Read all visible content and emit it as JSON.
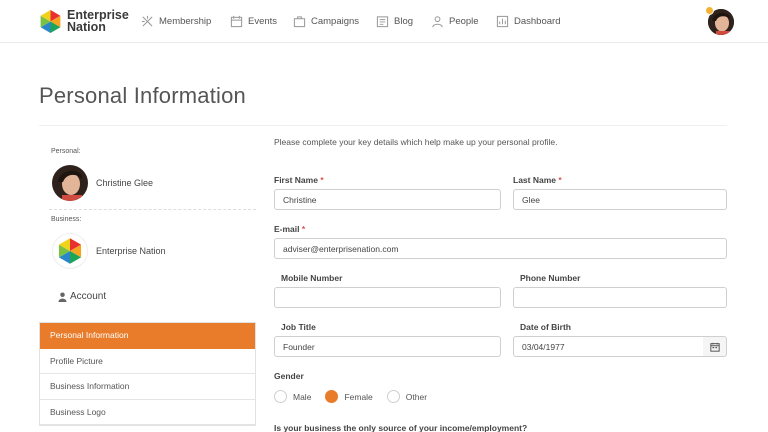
{
  "header": {
    "logo_line1": "Enterprise",
    "logo_line2": "Nation",
    "nav": [
      {
        "label": "Membership",
        "icon": "membership-icon"
      },
      {
        "label": "Events",
        "icon": "events-icon"
      },
      {
        "label": "Campaigns",
        "icon": "campaigns-icon"
      },
      {
        "label": "Blog",
        "icon": "blog-icon"
      },
      {
        "label": "People",
        "icon": "people-icon"
      },
      {
        "label": "Dashboard",
        "icon": "dashboard-icon"
      }
    ]
  },
  "page": {
    "title": "Personal Information"
  },
  "sidebar": {
    "personal_label": "Personal:",
    "personal_name": "Christine Glee",
    "business_label": "Business:",
    "business_name": "Enterprise Nation",
    "account_label": "Account",
    "menu": [
      {
        "label": "Personal Information",
        "active": true
      },
      {
        "label": "Profile Picture",
        "active": false
      },
      {
        "label": "Business Information",
        "active": false
      },
      {
        "label": "Business Logo",
        "active": false
      }
    ]
  },
  "form": {
    "intro": "Please complete your key details which help make up your personal profile.",
    "first_name": {
      "label": "First Name",
      "required": "*",
      "value": "Christine"
    },
    "last_name": {
      "label": "Last Name",
      "required": "*",
      "value": "Glee"
    },
    "email": {
      "label": "E-mail",
      "required": "*",
      "value": "adviser@enterprisenation.com"
    },
    "mobile": {
      "label": "Mobile Number",
      "value": ""
    },
    "phone": {
      "label": "Phone Number",
      "value": ""
    },
    "job_title": {
      "label": "Job Title",
      "value": "Founder"
    },
    "dob": {
      "label": "Date of Birth",
      "value": "03/04/1977"
    },
    "gender": {
      "label": "Gender",
      "options": [
        "Male",
        "Female",
        "Other"
      ],
      "selected": "Female"
    },
    "income_question": "Is your business the only source of your income/employment?"
  },
  "colors": {
    "accent": "#e87c2a",
    "required": "#d9534f",
    "badge": "#f3b233"
  }
}
